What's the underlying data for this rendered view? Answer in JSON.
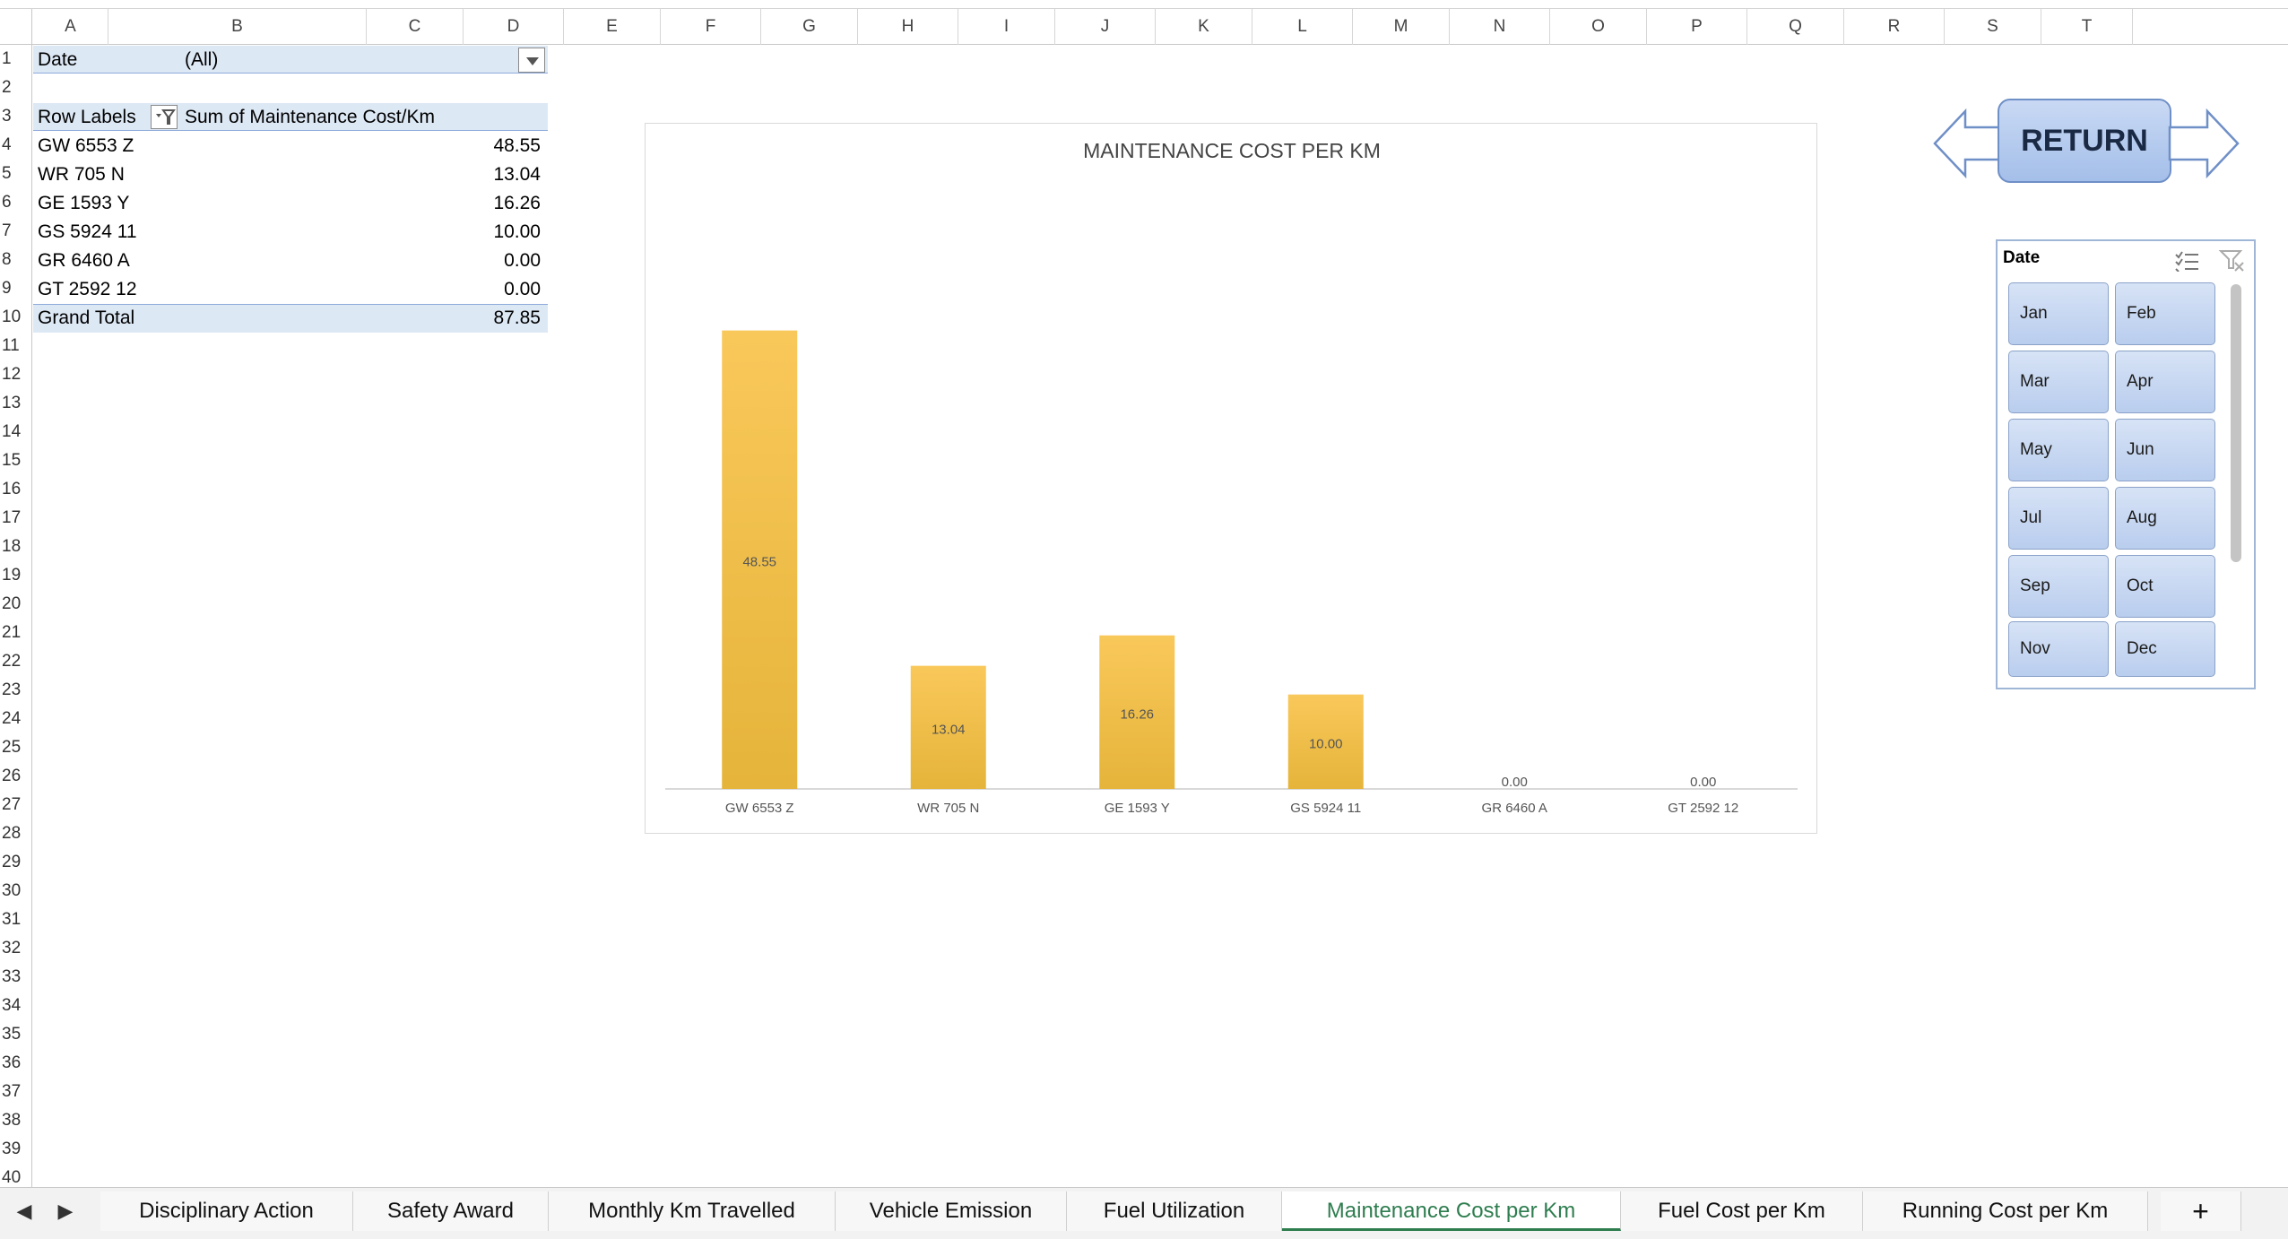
{
  "columns": [
    "A",
    "B",
    "C",
    "D",
    "E",
    "F",
    "G",
    "H",
    "I",
    "J",
    "K",
    "L",
    "M",
    "N",
    "O",
    "P",
    "Q",
    "R",
    "S",
    "T"
  ],
  "rows": [
    "1",
    "2",
    "3",
    "4",
    "5",
    "6",
    "7",
    "8",
    "9",
    "10",
    "11",
    "12",
    "13",
    "14",
    "15",
    "16",
    "17",
    "18",
    "19",
    "20",
    "21",
    "22",
    "23",
    "24",
    "25",
    "26",
    "27",
    "28",
    "29",
    "30",
    "31",
    "32",
    "33",
    "34",
    "35",
    "36",
    "37",
    "38",
    "39",
    "40"
  ],
  "pivot": {
    "filter_label": "Date",
    "filter_value": "(All)",
    "row_labels_header": "Row Labels",
    "value_header": "Sum of Maintenance Cost/Km",
    "items": [
      {
        "label": "GW 6553 Z",
        "value": "48.55"
      },
      {
        "label": "WR 705 N",
        "value": "13.04"
      },
      {
        "label": "GE 1593 Y",
        "value": "16.26"
      },
      {
        "label": "GS 5924 11",
        "value": "10.00"
      },
      {
        "label": "GR 6460 A",
        "value": "0.00"
      },
      {
        "label": "GT 2592 12",
        "value": "0.00"
      }
    ],
    "grand_total_label": "Grand Total",
    "grand_total_value": "87.85"
  },
  "chart_data": {
    "type": "bar",
    "title": "MAINTENANCE COST PER KM",
    "categories": [
      "GW 6553 Z",
      "WR 705 N",
      "GE 1593 Y",
      "GS 5924 11",
      "GR 6460 A",
      "GT 2592 12"
    ],
    "values": [
      48.55,
      13.04,
      16.26,
      10.0,
      0.0,
      0.0
    ],
    "data_labels": [
      "48.55",
      "13.04",
      "16.26",
      "10.00",
      "0.00",
      "0.00"
    ],
    "xlabel": "",
    "ylabel": "",
    "ylim": [
      0,
      60
    ],
    "grid": false,
    "legend": false,
    "bar_color_top": "#f9c85a",
    "bar_color_bottom": "#e5b43a"
  },
  "return_button": {
    "label": "RETURN"
  },
  "slicer": {
    "title": "Date",
    "items": [
      "Jan",
      "Feb",
      "Mar",
      "Apr",
      "May",
      "Jun",
      "Jul",
      "Aug",
      "Sep",
      "Oct",
      "Nov",
      "Dec"
    ]
  },
  "sheet_tabs": [
    "Disciplinary Action",
    "Safety Award",
    "Monthly Km Travelled",
    "Vehicle Emission",
    "Fuel Utilization",
    "Maintenance Cost per Km",
    "Fuel Cost per Km",
    "Running Cost per Km"
  ],
  "active_tab": "Maintenance Cost per Km",
  "add_sheet_label": "+",
  "colors": {
    "active_tab": "#2e7d4f",
    "accent_blue": "#6f8fc7",
    "pivot_band": "#dde8f5"
  }
}
